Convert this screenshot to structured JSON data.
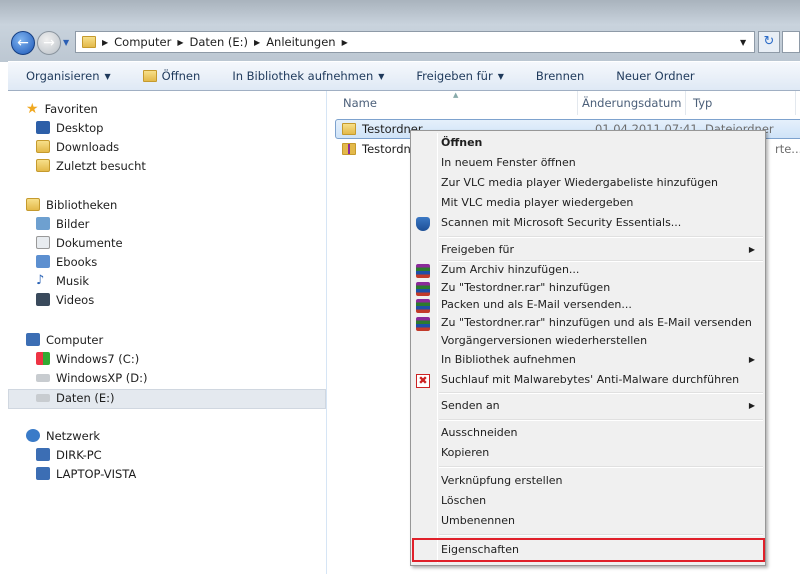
{
  "address_bar": {
    "segments": [
      "Computer",
      "Daten (E:)",
      "Anleitungen"
    ]
  },
  "toolbar": {
    "organize": "Organisieren",
    "open": "Öffnen",
    "include_library": "In Bibliothek aufnehmen",
    "share": "Freigeben für",
    "burn": "Brennen",
    "new_folder": "Neuer Ordner"
  },
  "sidebar": {
    "favorites": {
      "label": "Favoriten",
      "items": [
        "Desktop",
        "Downloads",
        "Zuletzt besucht"
      ]
    },
    "libraries": {
      "label": "Bibliotheken",
      "items": [
        "Bilder",
        "Dokumente",
        "Ebooks",
        "Musik",
        "Videos"
      ]
    },
    "computer": {
      "label": "Computer",
      "items": [
        "Windows7 (C:)",
        "WindowsXP (D:)",
        "Daten (E:)"
      ],
      "selected": "Daten (E:)"
    },
    "network": {
      "label": "Netzwerk",
      "items": [
        "DIRK-PC",
        "LAPTOP-VISTA"
      ]
    }
  },
  "columns": {
    "name": "Name",
    "date": "Änderungsdatum",
    "type": "Typ"
  },
  "files": [
    {
      "name": "Testordner",
      "date": "01.04.2011 07:41",
      "type": "Dateiordner"
    },
    {
      "name": "Testordne",
      "type_tail": "rte..."
    }
  ],
  "context_menu": {
    "items": [
      "Öffnen",
      "In neuem Fenster öffnen",
      "Zur VLC media player Wiedergabeliste hinzufügen",
      "Mit VLC media player wiedergeben",
      "Scannen mit Microsoft Security Essentials...",
      "Freigeben für",
      "Zum Archiv hinzufügen...",
      "Zu \"Testordner.rar\" hinzufügen",
      "Packen und als E-Mail versenden...",
      "Zu \"Testordner.rar\" hinzufügen und als E-Mail versenden",
      "Vorgängerversionen wiederherstellen",
      "In Bibliothek aufnehmen",
      "Suchlauf mit Malwarebytes' Anti-Malware durchführen",
      "Senden an",
      "Ausschneiden",
      "Kopieren",
      "Verknüpfung erstellen",
      "Löschen",
      "Umbenennen",
      "Eigenschaften"
    ],
    "highlighted": "Eigenschaften",
    "highlight_color": "#e0202a"
  }
}
